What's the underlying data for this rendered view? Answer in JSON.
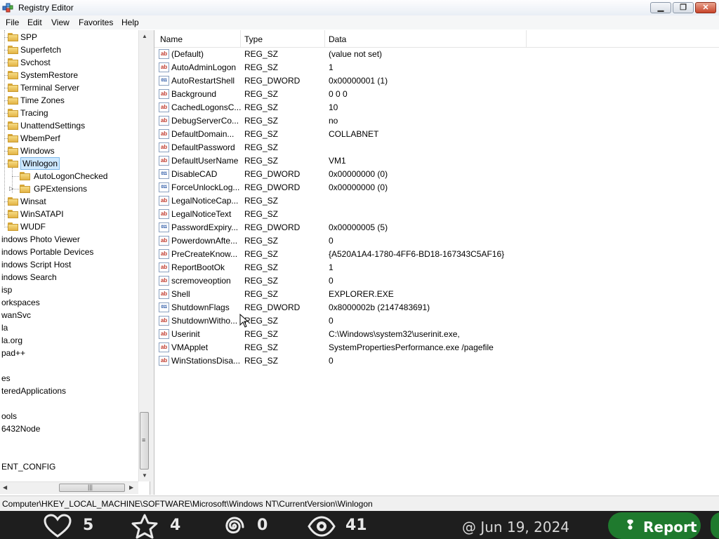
{
  "window": {
    "title": "Registry Editor"
  },
  "menu": [
    "File",
    "Edit",
    "View",
    "Favorites",
    "Help"
  ],
  "tree": {
    "items": [
      {
        "label": "SPP",
        "indent": 1
      },
      {
        "label": "Superfetch",
        "indent": 1
      },
      {
        "label": "Svchost",
        "indent": 1
      },
      {
        "label": "SystemRestore",
        "indent": 1
      },
      {
        "label": "Terminal Server",
        "indent": 1
      },
      {
        "label": "Time Zones",
        "indent": 1
      },
      {
        "label": "Tracing",
        "indent": 1
      },
      {
        "label": "UnattendSettings",
        "indent": 1
      },
      {
        "label": "WbemPerf",
        "indent": 1
      },
      {
        "label": "Windows",
        "indent": 1
      },
      {
        "label": "Winlogon",
        "indent": 1,
        "selected": true
      },
      {
        "label": "AutoLogonChecked",
        "indent": 2
      },
      {
        "label": "GPExtensions",
        "indent": 2,
        "expandable": true
      },
      {
        "label": "Winsat",
        "indent": 1
      },
      {
        "label": "WinSATAPI",
        "indent": 1
      },
      {
        "label": "WUDF",
        "indent": 1
      },
      {
        "label": "indows Photo Viewer",
        "indent": 0
      },
      {
        "label": "indows Portable Devices",
        "indent": 0
      },
      {
        "label": "indows Script Host",
        "indent": 0
      },
      {
        "label": "indows Search",
        "indent": 0
      },
      {
        "label": "isp",
        "indent": 0
      },
      {
        "label": "orkspaces",
        "indent": 0
      },
      {
        "label": "wanSvc",
        "indent": 0
      },
      {
        "label": "la",
        "indent": 0
      },
      {
        "label": "la.org",
        "indent": 0
      },
      {
        "label": "pad++",
        "indent": 0
      },
      {
        "label": "",
        "indent": 0
      },
      {
        "label": "es",
        "indent": 0
      },
      {
        "label": "teredApplications",
        "indent": 0
      },
      {
        "label": "",
        "indent": 0
      },
      {
        "label": "ools",
        "indent": 0
      },
      {
        "label": "6432Node",
        "indent": 0
      },
      {
        "label": "",
        "indent": 0
      },
      {
        "label": "",
        "indent": 0
      },
      {
        "label": "ENT_CONFIG",
        "indent": 0
      }
    ]
  },
  "list": {
    "columns": [
      "Name",
      "Type",
      "Data"
    ],
    "rows": [
      {
        "name": "(Default)",
        "type": "REG_SZ",
        "data": "(value not set)"
      },
      {
        "name": "AutoAdminLogon",
        "type": "REG_SZ",
        "data": "1"
      },
      {
        "name": "AutoRestartShell",
        "type": "REG_DWORD",
        "data": "0x00000001 (1)"
      },
      {
        "name": "Background",
        "type": "REG_SZ",
        "data": "0 0 0"
      },
      {
        "name": "CachedLogonsC...",
        "type": "REG_SZ",
        "data": "10"
      },
      {
        "name": "DebugServerCo...",
        "type": "REG_SZ",
        "data": "no"
      },
      {
        "name": "DefaultDomain...",
        "type": "REG_SZ",
        "data": "COLLABNET"
      },
      {
        "name": "DefaultPassword",
        "type": "REG_SZ",
        "data": ""
      },
      {
        "name": "DefaultUserName",
        "type": "REG_SZ",
        "data": "VM1"
      },
      {
        "name": "DisableCAD",
        "type": "REG_DWORD",
        "data": "0x00000000 (0)"
      },
      {
        "name": "ForceUnlockLog...",
        "type": "REG_DWORD",
        "data": "0x00000000 (0)"
      },
      {
        "name": "LegalNoticeCap...",
        "type": "REG_SZ",
        "data": ""
      },
      {
        "name": "LegalNoticeText",
        "type": "REG_SZ",
        "data": ""
      },
      {
        "name": "PasswordExpiry...",
        "type": "REG_DWORD",
        "data": "0x00000005 (5)"
      },
      {
        "name": "PowerdownAfte...",
        "type": "REG_SZ",
        "data": "0"
      },
      {
        "name": "PreCreateKnow...",
        "type": "REG_SZ",
        "data": "{A520A1A4-1780-4FF6-BD18-167343C5AF16}"
      },
      {
        "name": "ReportBootOk",
        "type": "REG_SZ",
        "data": "1"
      },
      {
        "name": "scremoveoption",
        "type": "REG_SZ",
        "data": "0"
      },
      {
        "name": "Shell",
        "type": "REG_SZ",
        "data": "EXPLORER.EXE"
      },
      {
        "name": "ShutdownFlags",
        "type": "REG_DWORD",
        "data": "0x8000002b (2147483691)"
      },
      {
        "name": "ShutdownWitho...",
        "type": "REG_SZ",
        "data": "0"
      },
      {
        "name": "Userinit",
        "type": "REG_SZ",
        "data": "C:\\Windows\\system32\\userinit.exe,"
      },
      {
        "name": "VMApplet",
        "type": "REG_SZ",
        "data": "SystemPropertiesPerformance.exe /pagefile"
      },
      {
        "name": "WinStationsDisa...",
        "type": "REG_SZ",
        "data": "0"
      }
    ]
  },
  "status": {
    "path": "Computer\\HKEY_LOCAL_MACHINE\\SOFTWARE\\Microsoft\\Windows NT\\CurrentVersion\\Winlogon"
  },
  "overlay": {
    "likes": "5",
    "stars": "4",
    "spiral": "0",
    "views": "41",
    "date": "Jun 19, 2024",
    "report_label": "Report",
    "accent": "#1f7a2e"
  }
}
